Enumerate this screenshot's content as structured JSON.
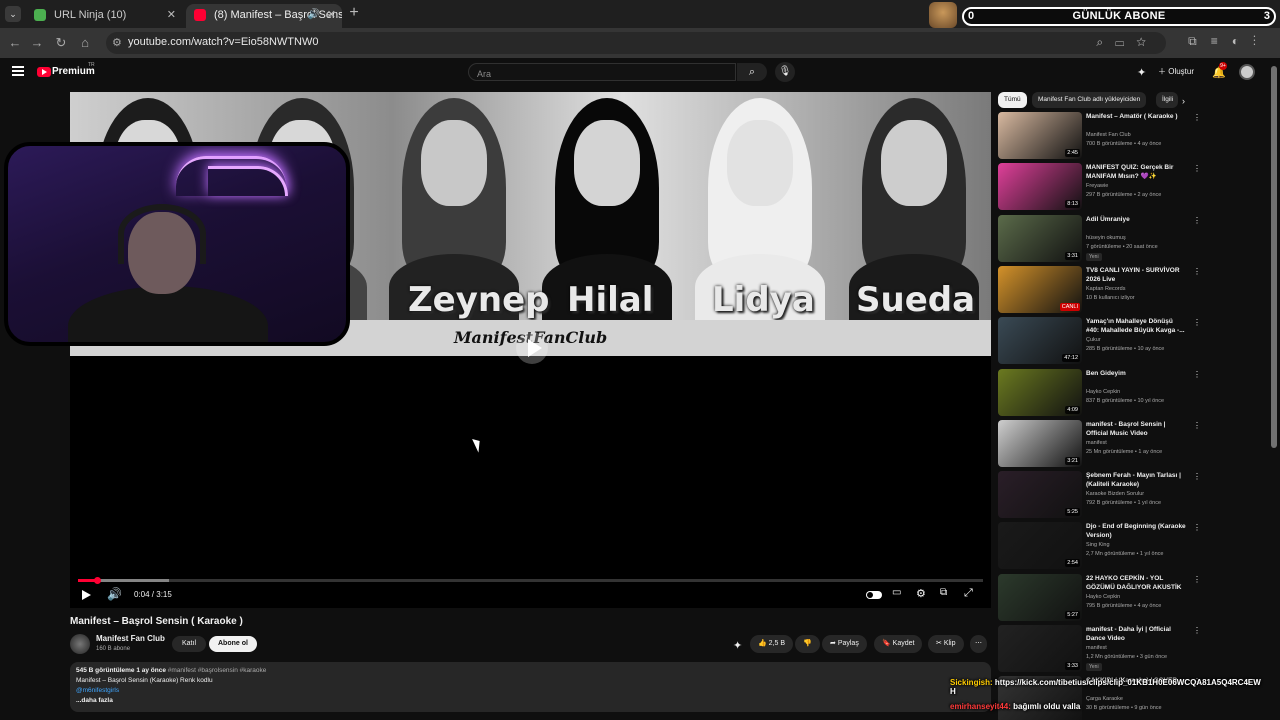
{
  "browser": {
    "tabs": [
      {
        "title": "URL Ninja (10)",
        "active": false
      },
      {
        "title": "(8) Manifest – Başrol Sensin",
        "active": true
      }
    ],
    "url": "youtube.com/watch?v=Eio58NWTNW0"
  },
  "overlay": {
    "count": "0",
    "title": "GÜNLÜK ABONE",
    "goal": "3"
  },
  "masthead": {
    "brand": "Premium",
    "country": "TR",
    "search_placeholder": "Ara",
    "create_label": "Oluştur",
    "notifications": "9+"
  },
  "player": {
    "names": [
      "Zeynep",
      "Hilal",
      "Lidya",
      "Sueda"
    ],
    "fanclub": "ManifestFanClub",
    "time": "0:04 / 3:15",
    "progress_fraction": 0.021,
    "buffered_fraction": 0.1
  },
  "video": {
    "title": "Manifest – Başrol Sensin ( Karaoke )",
    "channel": "Manifest Fan Club",
    "subs": "160 B abone",
    "join": "Katıl",
    "subscribe": "Abone ol",
    "likes": "2,5 B",
    "share": "Paylaş",
    "save": "Kaydet",
    "clip": "Klip",
    "desc_stats": "545 B görüntüleme  1 ay önce",
    "desc_tags": "#manifest #başrolsensin #karaoke",
    "desc_line2": "Manifest – Başrol Sensin (Karaoke) Renk kodlu",
    "desc_link": "@m6nifestgirls",
    "desc_more": "...daha fazla"
  },
  "sidebar": {
    "chips": [
      "Tümü",
      "Manifest Fan Club adlı yükleyiciden",
      "İlgili"
    ],
    "recs": [
      {
        "title": "Manifest – Amatör ( Karaoke )",
        "channel": "Manifest Fan Club",
        "meta": "700 B görüntüleme • 4 ay önce",
        "duration": "2:45",
        "color": "#d8b9a0"
      },
      {
        "title": "MANIFEST QUIZ: Gerçek Bir MANIFAM Mısın? 💜✨",
        "channel": "Freyawie",
        "meta": "297 B görüntüleme • 2 ay önce",
        "duration": "8:13",
        "color": "#e0409a"
      },
      {
        "title": "Adil Ümraniye",
        "channel": "hüseyin okumuş",
        "meta": "7 görüntüleme • 20 saat önce",
        "duration": "3:31",
        "color": "#5b6b4a",
        "new": "Yeni"
      },
      {
        "title": "TV8 CANLI YAYIN - SURVİVOR 2026 Live",
        "channel": "Kaptan Records",
        "meta": "10 B kullanıcı izliyor",
        "live": "CANLI",
        "color": "#d4922a"
      },
      {
        "title": "Yamaç'ın Mahalleye Dönüşü #40: Mahallede Büyük Kavga -...",
        "channel": "Çukur",
        "meta": "285 B görüntüleme • 10 ay önce",
        "duration": "47:12",
        "color": "#3a4a55"
      },
      {
        "title": "Ben Gideyim",
        "channel": "Hayko Cepkin",
        "meta": "837 B görüntüleme • 10 yıl önce",
        "duration": "4:09",
        "color": "#6b7a20"
      },
      {
        "title": "manifest - Başrol Sensin | Official Music Video",
        "channel": "manifest",
        "meta": "25 Mn görüntüleme • 1 ay önce",
        "duration": "3:21",
        "color": "#cfcfcf"
      },
      {
        "title": "Şebnem Ferah - Mayın Tarlası | (Kaliteli Karaoke)",
        "channel": "Karaoke Bizden Sorulur",
        "meta": "792 B görüntüleme • 1 yıl önce",
        "duration": "5:25",
        "color": "#2a1e28"
      },
      {
        "title": "Djo - End of Beginning (Karaoke Version)",
        "channel": "Sing King",
        "meta": "2,7 Mn görüntüleme • 1 yıl önce",
        "duration": "2:54",
        "color": "#1a1a1a"
      },
      {
        "title": "22 HAYKO CEPKİN - YOL GÖZÜMÜ DAĞLIYOR AKUSTİK ...",
        "channel": "Hayko Cepkin",
        "meta": "795 B görüntüleme • 4 ay önce",
        "duration": "5:27",
        "color": "#2c3a2c"
      },
      {
        "title": "manifest - Daha İyi | Official Dance Video",
        "channel": "manifest",
        "meta": "1,2 Mn görüntüleme • 3 gün önce",
        "duration": "3:33",
        "color": "#222",
        "new": "Yeni"
      },
      {
        "title": "ÇAKKIDI / (Karaoke) / COVER",
        "channel": "Çarga Karaoke",
        "meta": "30 B görüntüleme • 9 gün önce",
        "duration": "",
        "color": "#333"
      }
    ]
  },
  "chat": {
    "line1_user": "Sickingish:",
    "line1_text": "https://kick.com/tibetius/clips/clip_01KB1H0E06WCQA81A5Q4RC4EW",
    "line2_text": "H",
    "line3_user": "emirhanseyit44:",
    "line3_text": "bağımlı oldu valla"
  }
}
